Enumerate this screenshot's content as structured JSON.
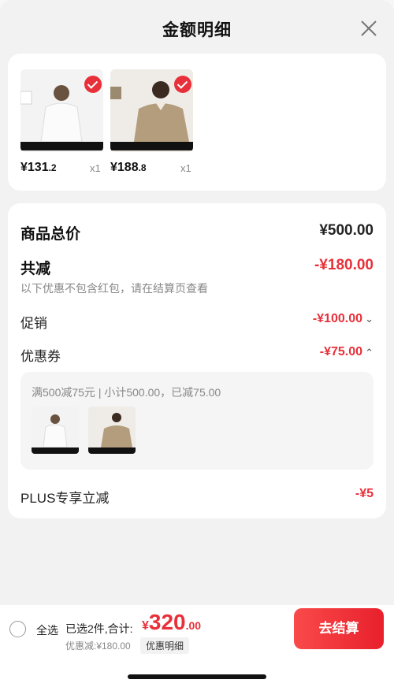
{
  "header": {
    "title": "金额明细"
  },
  "products": [
    {
      "price_int": "¥131",
      "price_dec": ".2",
      "qty": "x1"
    },
    {
      "price_int": "¥188",
      "price_dec": ".8",
      "qty": "x1"
    }
  ],
  "detail": {
    "total_label": "商品总价",
    "total_value": "¥500.00",
    "reduce_label": "共减",
    "reduce_value": "-¥180.00",
    "reduce_note": "以下优惠不包含红包，请在结算页查看",
    "promo_label": "促销",
    "promo_value": "-¥100.00",
    "coupon_label": "优惠券",
    "coupon_value": "-¥75.00",
    "coupon_rule": "满500减75元 | 小计500.00，已减75.00",
    "plus_label": "PLUS专享立减",
    "plus_value": "-¥5"
  },
  "bottom": {
    "select_all": "全选",
    "summary": "已选2件,合计:",
    "currency": "¥",
    "total_int": "320",
    "total_dec": ".00",
    "discount": "优惠减:¥180.00",
    "detail_btn": "优惠明细",
    "checkout": "去结算"
  },
  "colors": {
    "accent": "#e8303a"
  }
}
